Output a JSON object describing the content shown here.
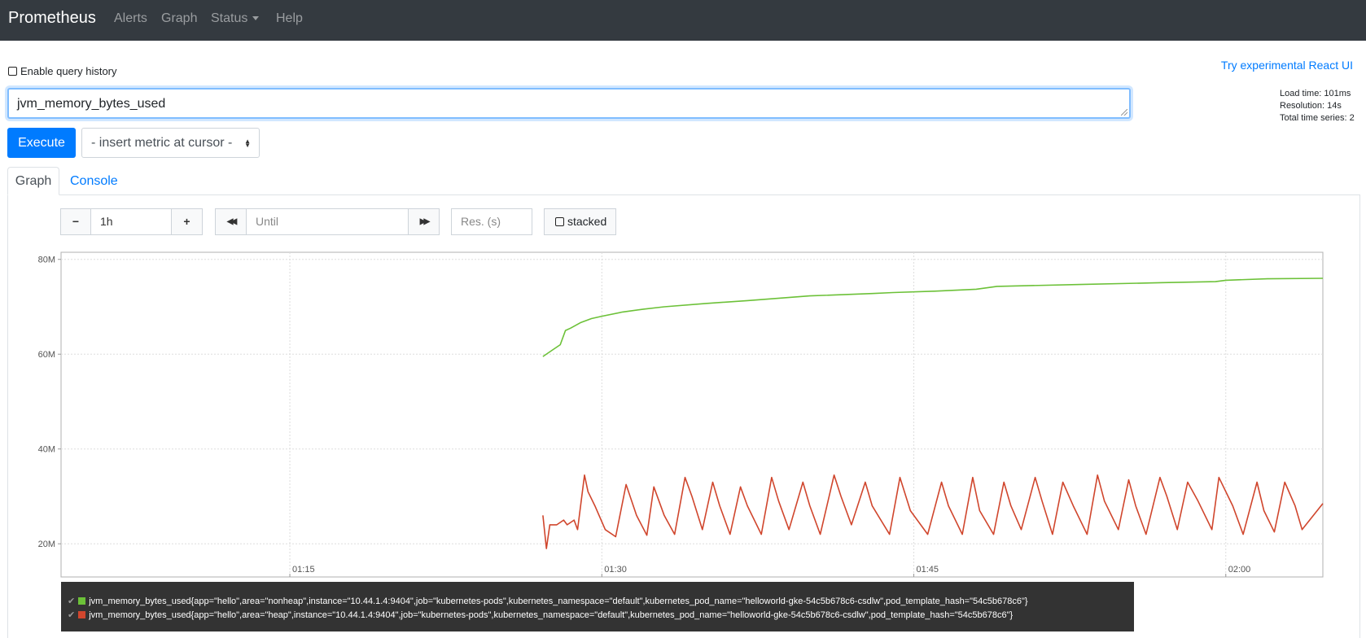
{
  "navbar": {
    "brand": "Prometheus",
    "items": [
      {
        "label": "Alerts"
      },
      {
        "label": "Graph"
      },
      {
        "label": "Status"
      },
      {
        "label": "Help"
      }
    ]
  },
  "query_history_label": "Enable query history",
  "react_ui_link": "Try experimental React UI",
  "expression": {
    "value": "jvm_memory_bytes_used"
  },
  "stats": {
    "load_time": "Load time: 101ms",
    "resolution": "Resolution: 14s",
    "total_series": "Total time series: 2"
  },
  "execute_label": "Execute",
  "insert_metric_label": "- insert metric at cursor -",
  "tabs": [
    {
      "label": "Graph"
    },
    {
      "label": "Console"
    }
  ],
  "controls": {
    "minus": "−",
    "range": "1h",
    "plus": "+",
    "back": "◀◀",
    "until_placeholder": "Until",
    "forward": "▶▶",
    "res_placeholder": "Res. (s)",
    "stacked_label": "stacked"
  },
  "colors": {
    "nonheap": "#6cc138",
    "heap": "#d0462d",
    "accent": "#007bff"
  },
  "chart_data": {
    "type": "line",
    "y_ticks": [
      "80M",
      "60M",
      "40M",
      "20M"
    ],
    "x_ticks": [
      "01:15",
      "01:30",
      "01:45",
      "02:00"
    ],
    "ylim": [
      13000000,
      81500000
    ],
    "series": [
      {
        "name": "jvm_memory_bytes_used{app=\"hello\",area=\"nonheap\",instance=\"10.44.1.4:9404\",job=\"kubernetes-pods\",kubernetes_namespace=\"default\",kubernetes_pod_name=\"helloworld-gke-54c5b678c6-csdlw\",pod_template_hash=\"54c5b678c6\"}",
        "color": "#6cc138",
        "x": [
          "01:27:10",
          "01:27:40",
          "01:28:00",
          "01:28:15",
          "01:28:30",
          "01:29:00",
          "01:29:30",
          "01:30:00",
          "01:31:00",
          "01:32:00",
          "01:33:00",
          "01:35:00",
          "01:37:00",
          "01:40:00",
          "01:43:00",
          "01:44:00",
          "01:46:00",
          "01:48:00",
          "01:49:00",
          "01:53:00",
          "01:57:00",
          "01:59:30",
          "02:00:00",
          "02:02:00",
          "02:04:40"
        ],
        "values": [
          59500000,
          61000000,
          62000000,
          65000000,
          65500000,
          66700000,
          67500000,
          68000000,
          68900000,
          69500000,
          70000000,
          70700000,
          71300000,
          72300000,
          72800000,
          73000000,
          73300000,
          73700000,
          74300000,
          74700000,
          75100000,
          75300000,
          75600000,
          75900000,
          76000000
        ]
      },
      {
        "name": "jvm_memory_bytes_used{app=\"hello\",area=\"heap\",instance=\"10.44.1.4:9404\",job=\"kubernetes-pods\",kubernetes_namespace=\"default\",kubernetes_pod_name=\"helloworld-gke-54c5b678c6-csdlw\",pod_template_hash=\"54c5b678c6\"}",
        "color": "#d0462d",
        "x": [
          "01:27:10",
          "01:27:20",
          "01:27:30",
          "01:27:50",
          "01:28:10",
          "01:28:20",
          "01:28:40",
          "01:28:50",
          "01:29:10",
          "01:29:20",
          "01:29:40",
          "01:30:10",
          "01:30:40",
          "01:31:10",
          "01:31:40",
          "01:32:10",
          "01:32:30",
          "01:33:00",
          "01:33:30",
          "01:34:00",
          "01:34:20",
          "01:34:50",
          "01:35:20",
          "01:35:40",
          "01:36:10",
          "01:36:40",
          "01:37:00",
          "01:37:40",
          "01:38:10",
          "01:38:30",
          "01:39:00",
          "01:39:40",
          "01:40:00",
          "01:40:30",
          "01:41:10",
          "01:41:30",
          "01:42:00",
          "01:42:40",
          "01:43:00",
          "01:43:50",
          "01:44:20",
          "01:44:50",
          "01:45:40",
          "01:46:20",
          "01:46:40",
          "01:47:20",
          "01:47:50",
          "01:48:10",
          "01:48:50",
          "01:49:20",
          "01:49:40",
          "01:50:10",
          "01:50:50",
          "01:51:10",
          "01:51:40",
          "01:52:10",
          "01:52:40",
          "01:53:20",
          "01:53:50",
          "01:54:10",
          "01:54:50",
          "01:55:20",
          "01:55:40",
          "01:56:10",
          "01:56:50",
          "01:57:10",
          "01:57:40",
          "01:58:10",
          "01:58:40",
          "01:59:20",
          "01:59:40",
          "02:00:20",
          "02:00:50",
          "02:01:30",
          "02:01:50",
          "02:02:20",
          "02:02:50",
          "02:03:20",
          "02:03:40",
          "02:04:40"
        ],
        "values": [
          26000000,
          19000000,
          24000000,
          24000000,
          25000000,
          24000000,
          25000000,
          23000000,
          34500000,
          31000000,
          28000000,
          23000000,
          21500000,
          32500000,
          26000000,
          21800000,
          32000000,
          26000000,
          22000000,
          34000000,
          30000000,
          23000000,
          33000000,
          28000000,
          22000000,
          32000000,
          28000000,
          22000000,
          34000000,
          29000000,
          23000000,
          33000000,
          28000000,
          22000000,
          34500000,
          30000000,
          24000000,
          33000000,
          28000000,
          22000000,
          34000000,
          27000000,
          22000000,
          33000000,
          28000000,
          22000000,
          34000000,
          27000000,
          22000000,
          33000000,
          28000000,
          23000000,
          34000000,
          29000000,
          22000000,
          33000000,
          28000000,
          22000000,
          34500000,
          29000000,
          23000000,
          33500000,
          28000000,
          22000000,
          34000000,
          30000000,
          23000000,
          33000000,
          29000000,
          23000000,
          34000000,
          28000000,
          22000000,
          33000000,
          27000000,
          22500000,
          33000000,
          28000000,
          23000000,
          28500000
        ]
      }
    ]
  }
}
